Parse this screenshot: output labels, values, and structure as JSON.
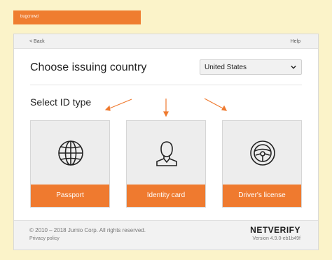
{
  "brand_bar": {
    "text": "bugcrowd"
  },
  "topbar": {
    "back_label": "< Back",
    "help_label": "Help"
  },
  "country": {
    "title": "Choose issuing country",
    "selected": "United States"
  },
  "id_type": {
    "title": "Select ID type",
    "options": [
      {
        "label": "Passport",
        "icon": "globe-icon"
      },
      {
        "label": "Identity card",
        "icon": "person-icon"
      },
      {
        "label": "Driver's license",
        "icon": "steering-wheel-icon"
      }
    ]
  },
  "footer": {
    "copyright": "© 2010 – 2018 Jumio Corp. All rights reserved.",
    "privacy": "Privacy policy",
    "logo": "NETVERIFY",
    "version": "Version 4.9.0-eb1b49f"
  },
  "colors": {
    "accent": "#ef7a2f",
    "background": "#fbf3c9"
  }
}
